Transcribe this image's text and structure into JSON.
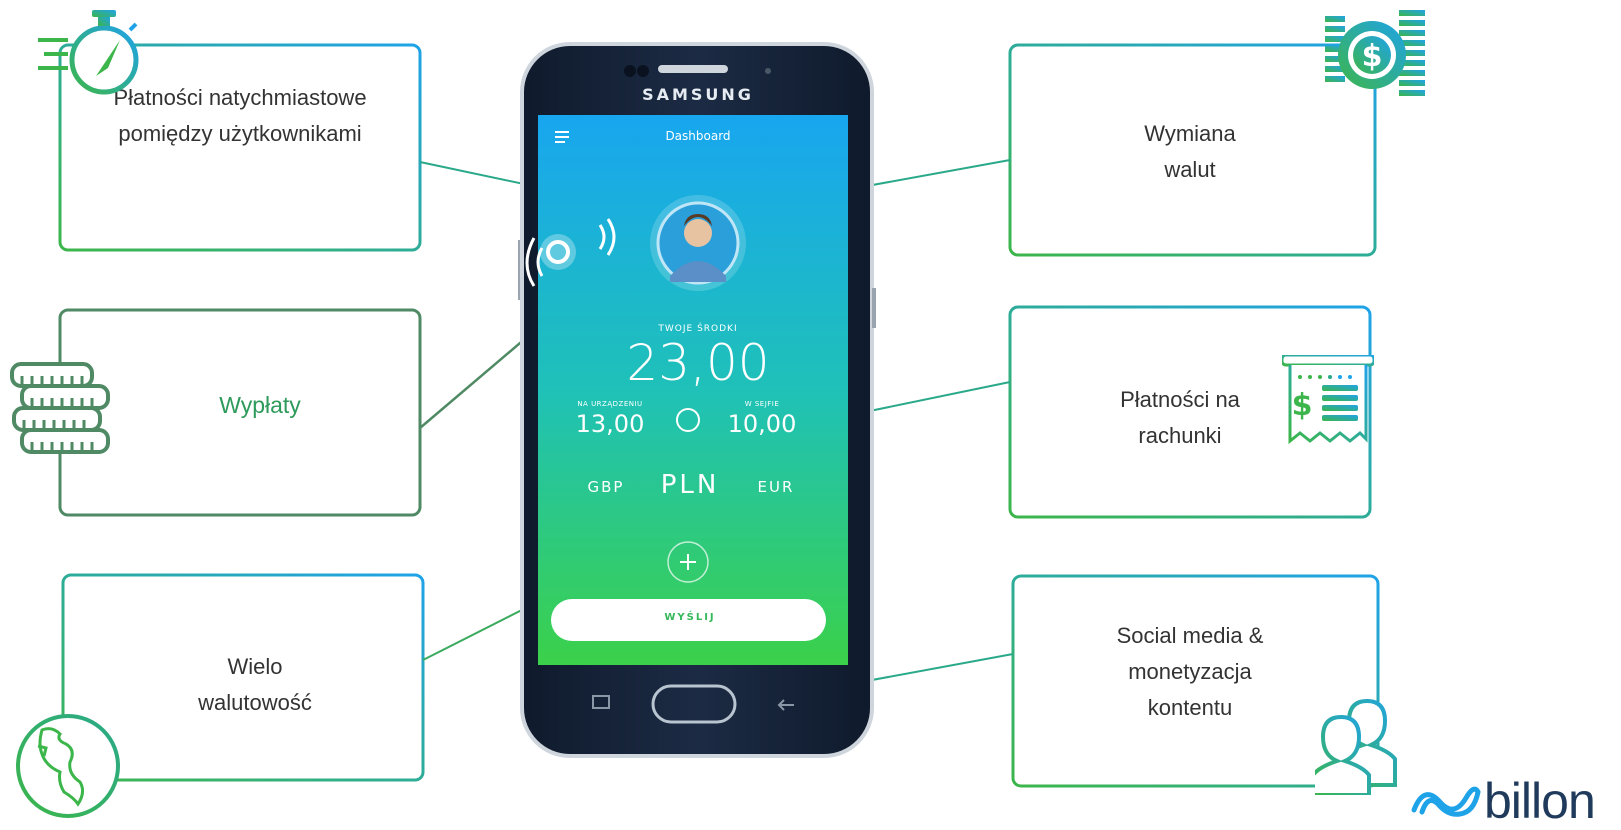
{
  "features": {
    "instant_payments": "Płatności natychmiastowe\npomiędzy użytkownikami",
    "withdrawals": "Wypłaty",
    "multi_currency": "Wielo\nwalutowość",
    "currency_exchange": "Wymiana\nwalut",
    "bill_payments": "Płatności na\nrachunki",
    "social_media": "Social media &\nmonetyzacja\nkontentu"
  },
  "phone": {
    "brand": "SAMSUNG",
    "screen_title": "Dashboard",
    "balance_label": "TWOJE ŚRODKI",
    "balance_value": "23,00",
    "device_label": "NA URZĄDZENIU",
    "device_value": "13,00",
    "safe_label": "W SEJFIE",
    "safe_value": "10,00",
    "currencies": [
      "GBP",
      "PLN",
      "EUR"
    ],
    "send_label": "WYŚLIJ"
  },
  "logo": {
    "text": "billon"
  },
  "colors": {
    "green": "#3cb64a",
    "blue": "#1fa3e8",
    "teal_line": "#2aa98a",
    "accent_text": "#2e9a5b",
    "logo_blue": "#1fa3e8",
    "logo_text": "#1f3a5a"
  },
  "icons": {
    "stopwatch": "stopwatch-icon",
    "coins": "coin-stack-icon",
    "globe": "globe-icon",
    "dollar_coins": "dollar-coin-stack-icon",
    "receipt": "receipt-icon",
    "users": "users-icon"
  }
}
